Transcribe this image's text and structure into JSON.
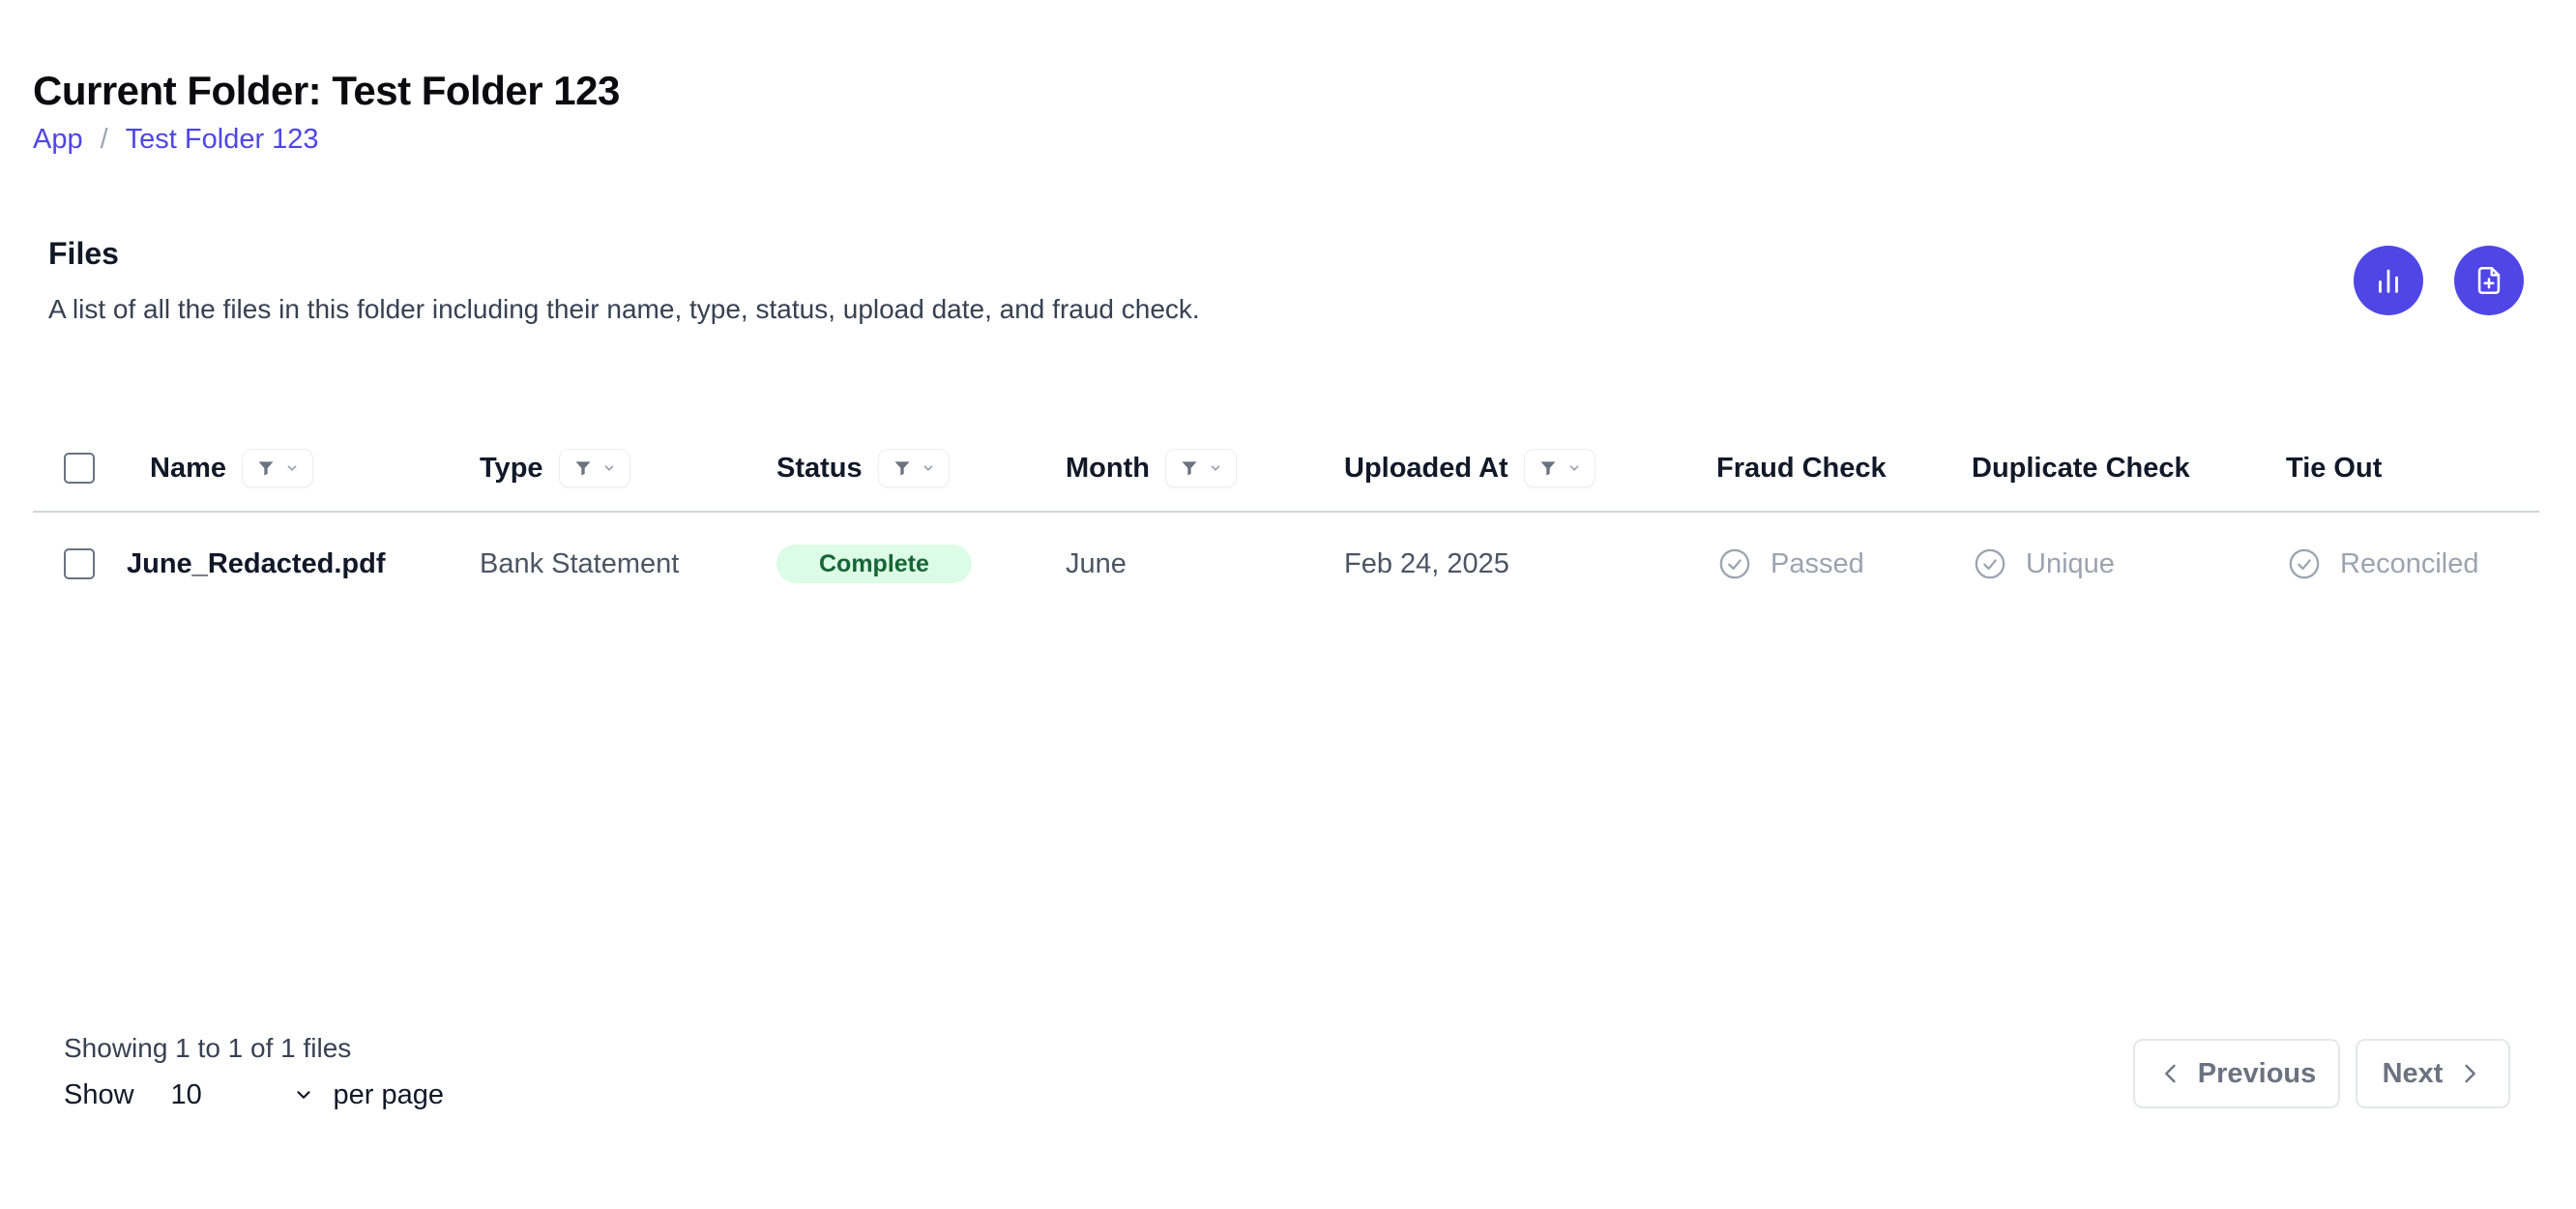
{
  "header": {
    "title": "Current Folder: Test Folder 123",
    "breadcrumb": [
      {
        "label": "App"
      },
      {
        "label": "Test Folder 123"
      }
    ],
    "separator": "/"
  },
  "section": {
    "title": "Files",
    "description": "A list of all the files in this folder including their name, type, status, upload date, and fraud check."
  },
  "actions": {
    "analytics_icon": "bar-chart-icon",
    "add_file_icon": "file-plus-icon"
  },
  "table": {
    "columns": {
      "name": "Name",
      "type": "Type",
      "status": "Status",
      "month": "Month",
      "uploaded_at": "Uploaded At",
      "fraud_check": "Fraud Check",
      "duplicate_check": "Duplicate Check",
      "tie_out": "Tie Out"
    },
    "rows": [
      {
        "name": "June_Redacted.pdf",
        "type": "Bank Statement",
        "status": "Complete",
        "month": "June",
        "uploaded_at": "Feb 24, 2025",
        "fraud_check": "Passed",
        "duplicate_check": "Unique",
        "tie_out": "Reconciled"
      }
    ]
  },
  "footer": {
    "showing": "Showing 1 to 1 of 1 files",
    "show_label": "Show",
    "page_size": "10",
    "per_page_label": "per page",
    "previous": "Previous",
    "next": "Next"
  },
  "colors": {
    "accent": "#4f46e5",
    "badge_bg": "#dcfce7",
    "badge_text": "#166534"
  }
}
